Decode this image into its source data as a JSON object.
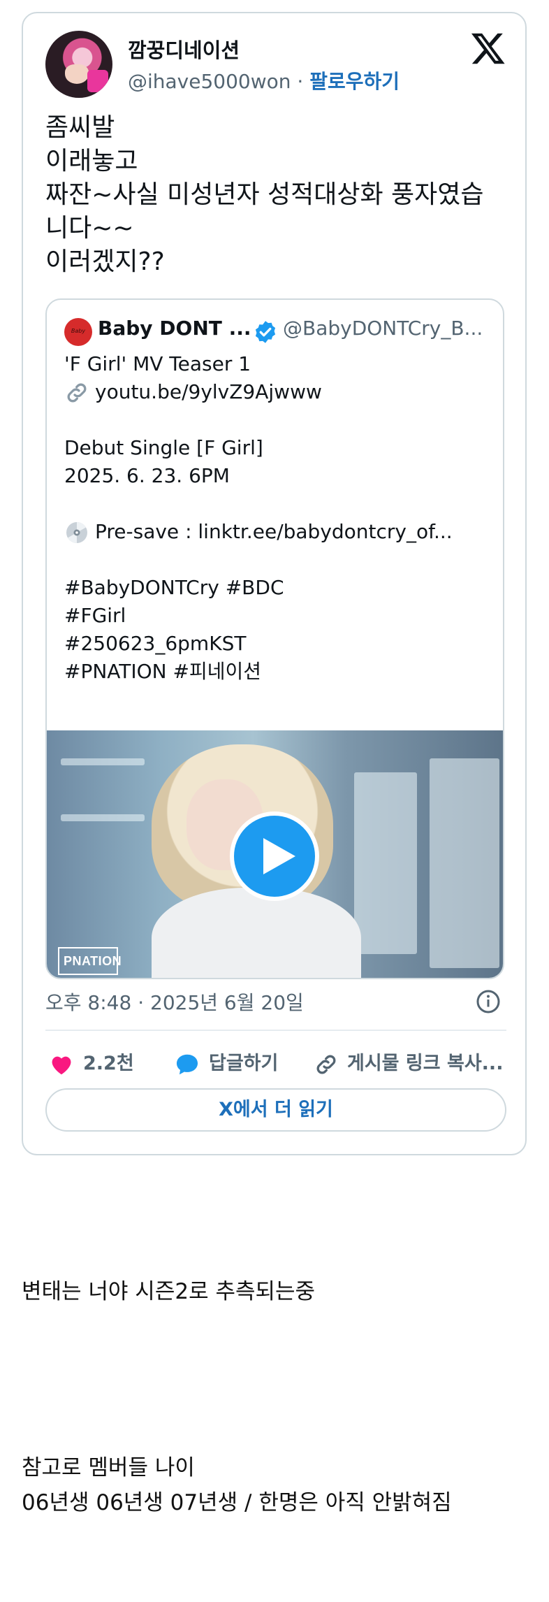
{
  "tweet": {
    "author_name": "깜꿍디네이션",
    "handle": "@ihave5000won",
    "separator": " · ",
    "follow_label": "팔로우하기",
    "text_lines": [
      "좀씨발",
      "이래놓고",
      "짜잔~사실 미성년자 성적대상화 풍자였습",
      "니다~~",
      "이러겠지??"
    ],
    "timestamp": "오후 8:48 · 2025년 6월 20일",
    "actions": {
      "like_count": "2.2천",
      "reply_label": "답글하기",
      "copy_link_label": "게시물 링크 복사..."
    },
    "read_more_label": "X에서 더 읽기"
  },
  "quote": {
    "author_name": "Baby DONT ...",
    "handle": "@BabyDONTCry_B...",
    "lines": [
      "'F Girl' MV Teaser 1",
      "youtu.be/9ylvZ9Ajwww",
      "",
      "Debut Single [F Girl]",
      "2025. 6. 23. 6PM",
      "",
      "Pre-save : linktr.ee/babydontcry_of...",
      "",
      " #BabyDONTCry #BDC",
      " #FGirl",
      " #250623_6pmKST",
      " #PNATION #피네이션"
    ],
    "media_logo": "PNATION",
    "avatar_text": "Baby"
  },
  "post": {
    "paragraph1": "변태는 너야 시즌2로 추측되는중",
    "paragraph2_line1": "참고로 멤버들 나이",
    "paragraph2_line2": "06년생 06년생 07년생 / 한명은 아직 안밝혀짐"
  },
  "colors": {
    "accent": "#1d9bf0",
    "link": "#1d6fba",
    "like": "#f91880",
    "muted": "#536471",
    "border": "#cfd9de"
  },
  "icons": [
    "x-logo-icon",
    "verified-badge-icon",
    "link-icon",
    "disc-icon",
    "play-icon",
    "info-icon",
    "heart-icon",
    "reply-bubble-icon",
    "copy-link-icon"
  ]
}
